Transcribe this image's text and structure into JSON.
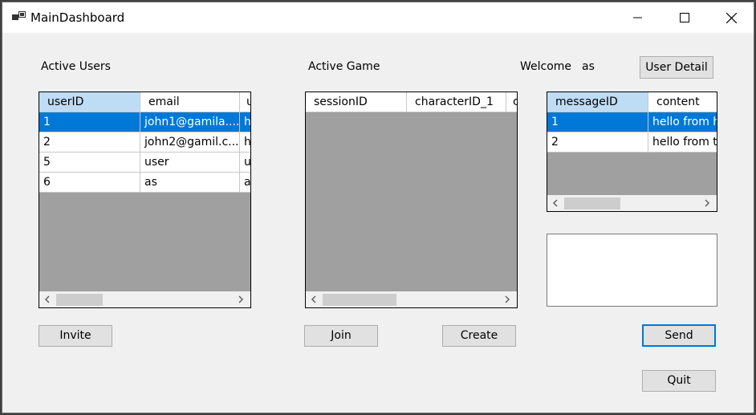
{
  "window": {
    "title": "MainDashboard"
  },
  "active_users": {
    "label": "Active Users",
    "columns": [
      "userID",
      "email",
      "u"
    ],
    "rows": [
      [
        "1",
        "john1@gamila....",
        "h"
      ],
      [
        "2",
        "john2@gamil.c...",
        "h"
      ],
      [
        "5",
        "user",
        "u"
      ],
      [
        "6",
        "as",
        "a"
      ]
    ],
    "invite_label": "Invite"
  },
  "active_game": {
    "label": "Active Game",
    "columns": [
      "sessionID",
      "characterID_1",
      "c"
    ],
    "join_label": "Join",
    "create_label": "Create"
  },
  "welcome": {
    "label": "Welcome",
    "username": "as",
    "user_detail_label": "User Detail"
  },
  "messages": {
    "columns": [
      "messageID",
      "content"
    ],
    "rows": [
      [
        "1",
        "hello from h"
      ],
      [
        "2",
        "hello from th"
      ]
    ],
    "input_value": "",
    "send_label": "Send"
  },
  "quit_label": "Quit",
  "colors": {
    "selection": "#0078d7",
    "sorted_header": "#bfdcf5",
    "grid_background": "#a0a0a0"
  }
}
